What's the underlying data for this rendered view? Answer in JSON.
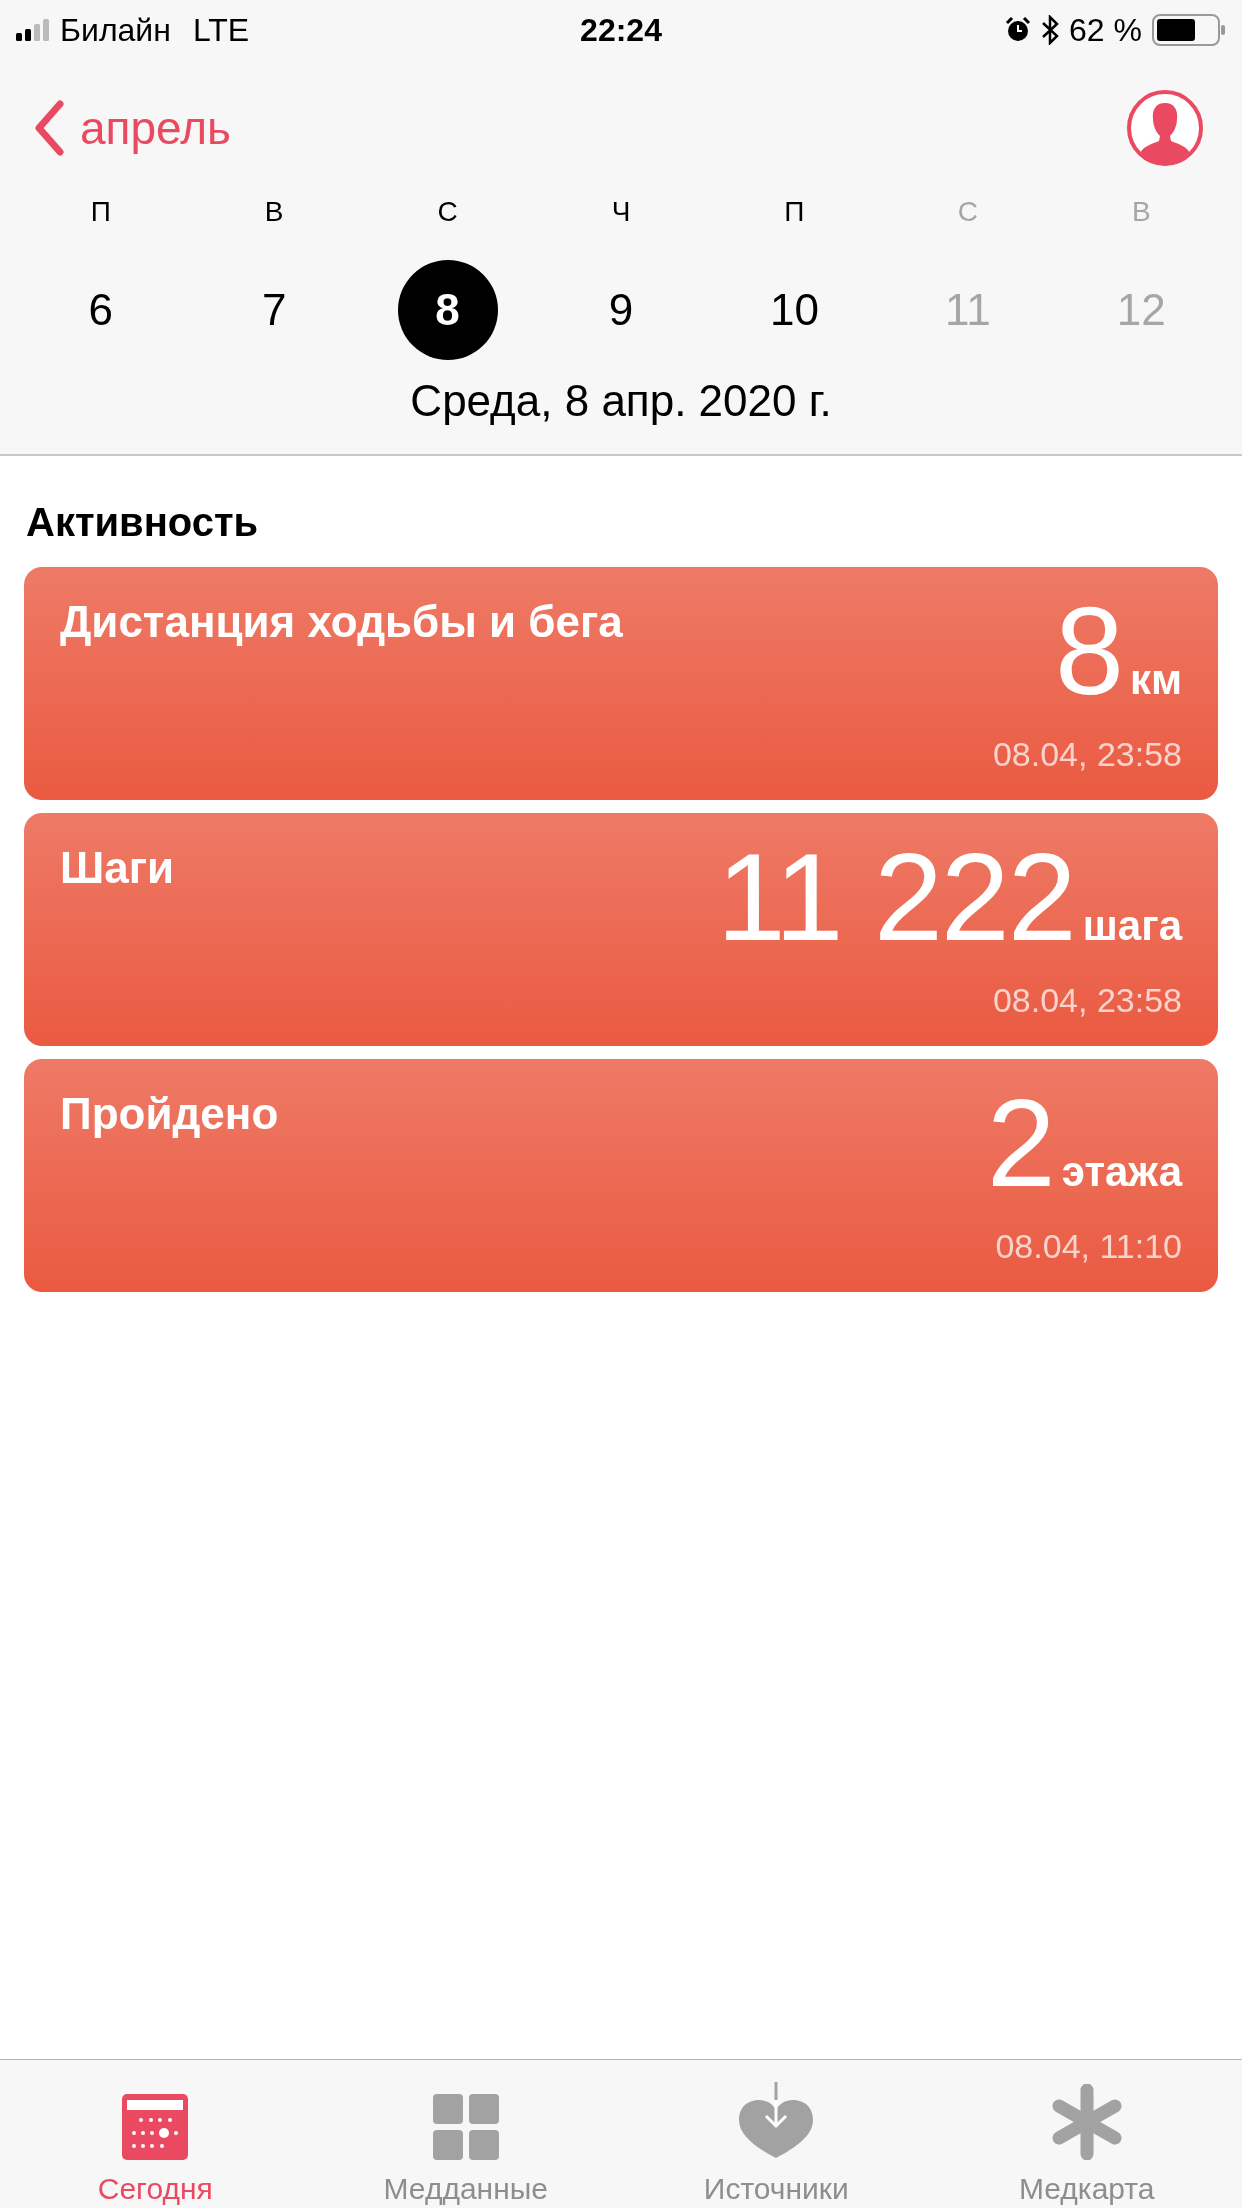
{
  "status_bar": {
    "carrier": "Билайн",
    "network": "LTE",
    "time": "22:24",
    "battery": "62 %"
  },
  "nav": {
    "back": "апрель"
  },
  "week": [
    {
      "letter": "П",
      "number": "6",
      "selected": false,
      "disabled": false
    },
    {
      "letter": "В",
      "number": "7",
      "selected": false,
      "disabled": false
    },
    {
      "letter": "С",
      "number": "8",
      "selected": true,
      "disabled": false
    },
    {
      "letter": "Ч",
      "number": "9",
      "selected": false,
      "disabled": false
    },
    {
      "letter": "П",
      "number": "10",
      "selected": false,
      "disabled": false
    },
    {
      "letter": "С",
      "number": "11",
      "selected": false,
      "disabled": true
    },
    {
      "letter": "В",
      "number": "12",
      "selected": false,
      "disabled": true
    }
  ],
  "date": "Среда, 8 апр. 2020 г.",
  "section": "Активность",
  "cards": [
    {
      "title": "Дистанция ходьбы и бега",
      "value": "8",
      "unit": "км",
      "time": "08.04, 23:58"
    },
    {
      "title": "Шаги",
      "value": "11 222",
      "unit": "шага",
      "time": "08.04, 23:58"
    },
    {
      "title": "Пройдено",
      "value": "2",
      "unit": "этажа",
      "time": "08.04, 11:10"
    }
  ],
  "tabs": [
    {
      "kind": "today",
      "label": "Сегодня",
      "selected": true
    },
    {
      "kind": "data",
      "label": "Медданные",
      "selected": false
    },
    {
      "kind": "sources",
      "label": "Источники",
      "selected": false
    },
    {
      "kind": "medical",
      "label": "Медкарта",
      "selected": false
    }
  ]
}
